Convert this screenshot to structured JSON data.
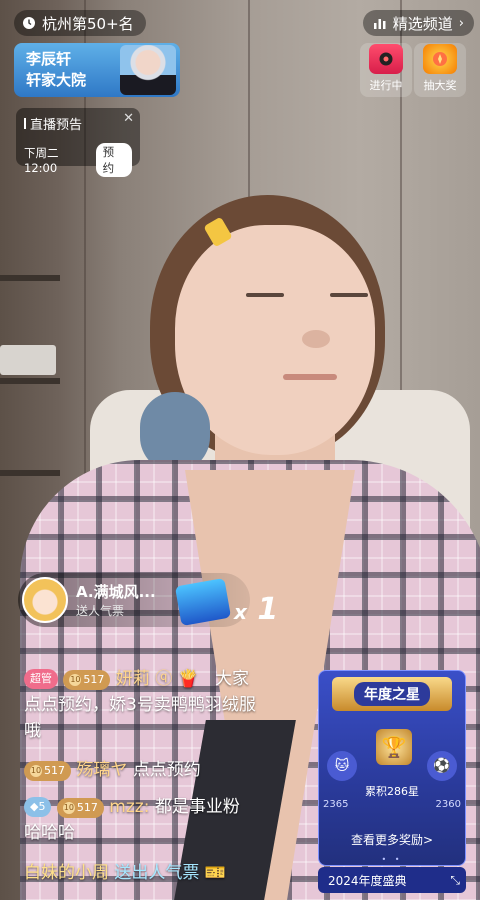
{
  "top": {
    "rank": "杭州第50+名",
    "channel": "精选频道"
  },
  "banner": {
    "line1": "李辰轩",
    "line2": "轩家大院"
  },
  "actions": {
    "live": {
      "label": "进行中"
    },
    "lottery": {
      "label": "抽大奖"
    }
  },
  "preview": {
    "title": "直播预告",
    "time": "下周二12:00",
    "reserve": "预约"
  },
  "gift": {
    "sender": "A.满城风...",
    "sub": "送人气票",
    "count_prefix": "x",
    "count": "1"
  },
  "chat": [
    {
      "badge": "超管",
      "level": "517",
      "user": "妍莉",
      "text_line1": "大家",
      "text_line2": "点点预约，娇3号卖鸭鸭羽绒服",
      "text_line3": "哦"
    },
    {
      "level": "517",
      "user": "殇璃ヤ",
      "text": "点点预约"
    },
    {
      "diamond": "5",
      "level": "517",
      "user": "mzz:",
      "text_line1": "都是事业粉",
      "text_line2": "哈哈哈"
    }
  ],
  "entry": {
    "user": "白妹的小周",
    "action": "送出人气票"
  },
  "star": {
    "title": "年度之星",
    "accum": "累积286星",
    "left_num": "2365",
    "right_num": "2360",
    "more": "查看更多奖励>",
    "dots": "• •",
    "year": "2024年度盛典"
  },
  "colors": {
    "accent_pink": "#f06c8b",
    "card_blue": "#2a3a9a",
    "gold": "#f9d98a"
  }
}
